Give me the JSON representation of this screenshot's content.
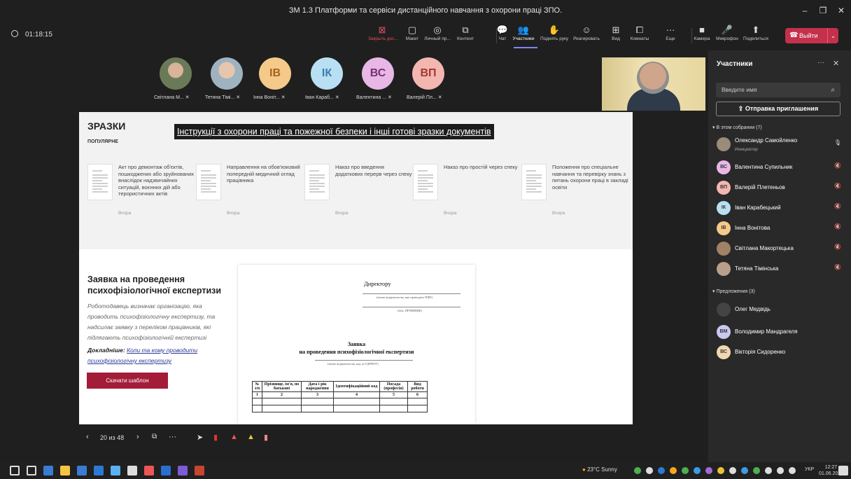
{
  "window": {
    "title": "ЗМ 1.3 Платформи та сервіси дистанційного навчання з охорони праці ЗПО."
  },
  "meeting": {
    "timer": "01:18:15"
  },
  "toolbar": {
    "items": [
      {
        "label": "Закрыть дос...",
        "icon": "⊠"
      },
      {
        "label": "Макет",
        "icon": "▢"
      },
      {
        "label": "Личный пр...",
        "icon": "◎"
      },
      {
        "label": "Контент",
        "icon": "⧉"
      },
      {
        "label": "Чат",
        "icon": "💬"
      },
      {
        "label": "Участники",
        "icon": "👥"
      },
      {
        "label": "Поднять руку",
        "icon": "✋"
      },
      {
        "label": "Реагировать",
        "icon": "☺"
      },
      {
        "label": "Вид",
        "icon": "⊞"
      },
      {
        "label": "Комнаты",
        "icon": "⧠"
      },
      {
        "label": "Еще",
        "icon": "···"
      },
      {
        "label": "Камера",
        "icon": "■"
      },
      {
        "label": "Микрофон",
        "icon": "🎤"
      },
      {
        "label": "Поделиться",
        "icon": "⬆"
      }
    ],
    "leave_label": "Выйти"
  },
  "gallery": [
    {
      "initials": "",
      "name": "Світлана М..."
    },
    {
      "initials": "",
      "name": "Тетяна Тімі..."
    },
    {
      "initials": "ІВ",
      "name": "Інна Воніт...",
      "color": "#f5c98a"
    },
    {
      "initials": "ІК",
      "name": "Іван Караб...",
      "color": "#b9dff2"
    },
    {
      "initials": "ВС",
      "name": "Валентина ...",
      "color": "#e8b7e6"
    },
    {
      "initials": "ВП",
      "name": "Валерій Пл...",
      "color": "#f3b6b0"
    }
  ],
  "slide": {
    "section_title": "ЗРАЗКИ",
    "popular": "ПОПУЛЯРНЕ",
    "banner": "Інструкції з охорони праці та пожежної безпеки і інші готові зразки документів",
    "docs": [
      {
        "text": "Акт про демонтаж об'єктів, пошкоджених або зруйнованих внаслідок надзвичайних ситуацій, воєнних дій або терористичних актів",
        "when": "Вчора"
      },
      {
        "text": "Направлення на обов'язковий попередній медичний огляд працівника",
        "when": "Вчора"
      },
      {
        "text": "Наказ про введення додаткових перерв через спеку",
        "when": "Вчора"
      },
      {
        "text": "Наказ про простій через спеку",
        "when": "Вчора"
      },
      {
        "text": "Положення про спеціальне навчання та перевірку знань з питань охорони праці в закладі освіти",
        "when": "Вчора"
      }
    ],
    "request_title": "Заявка на проведення психофізіологічної експертизи",
    "request_desc": "Роботодавець визначає організацію, яка проводить психофізіологічну експертизу, та надсилає заявку з переліком працівників, які підлягають психофізіологічній експертизі",
    "more_label": "Докладніше:",
    "more_link": "Коли та кому проводити психофізіологічну експертизу",
    "download": "Скачати шаблон",
    "preview": {
      "to": "Директору",
      "cap1": "(назва підприємства, яке проводить ПФЕ)",
      "cap2": "(ім'я, ПРІЗВИЩЕ)",
      "title1": "Заявка",
      "title2": "на проведення психофізіологічної експертизи",
      "cap3": "(назва підприємства, код за ЄДРПОУ)",
      "headers": [
        "№ з/п",
        "Прізвище, ім'я, по батькові",
        "Дата і рік народження",
        "Ідентифікаційний код",
        "Посада (професія)",
        "Вид роботи"
      ],
      "nums": [
        "1",
        "2",
        "3",
        "4",
        "5",
        "6"
      ]
    }
  },
  "slidebar": {
    "page": "20 из 48"
  },
  "panel": {
    "title": "Участники",
    "search_placeholder": "Введите имя",
    "invite": "Отправка приглашения",
    "in_meeting": "В этом собрании (7)",
    "suggestions": "Предложения (3)",
    "participants": [
      {
        "name": "Олександр Самойленко",
        "role": "Инициатор",
        "initials": "",
        "color": "#9a8b7a"
      },
      {
        "name": "Валентина Супильник",
        "initials": "ВС",
        "color": "#e8b7e6"
      },
      {
        "name": "Валерій Плетеньов",
        "initials": "ВП",
        "color": "#f3b6b0"
      },
      {
        "name": "Іван Карабецький",
        "initials": "ІК",
        "color": "#b9dff2"
      },
      {
        "name": "Інна Вонітова",
        "initials": "ІВ",
        "color": "#f5c98a"
      },
      {
        "name": "Світлана Макортецька",
        "initials": "",
        "color": "#a08266"
      },
      {
        "name": "Тетяна Тімінська",
        "initials": "",
        "color": "#b9a08a"
      }
    ],
    "suggested": [
      {
        "name": "Олег Медвідь",
        "initials": "",
        "color": "#444"
      },
      {
        "name": "Володимир Мандрагеля",
        "initials": "ВМ",
        "color": "#c8c8f0"
      },
      {
        "name": "Вікторія Сидоренко",
        "initials": "ВС",
        "color": "#f0d8b0"
      }
    ]
  },
  "taskbar": {
    "weather": "23°C Sunny",
    "lang": "УКР",
    "time": "12:27",
    "date": "01.06.2023"
  }
}
